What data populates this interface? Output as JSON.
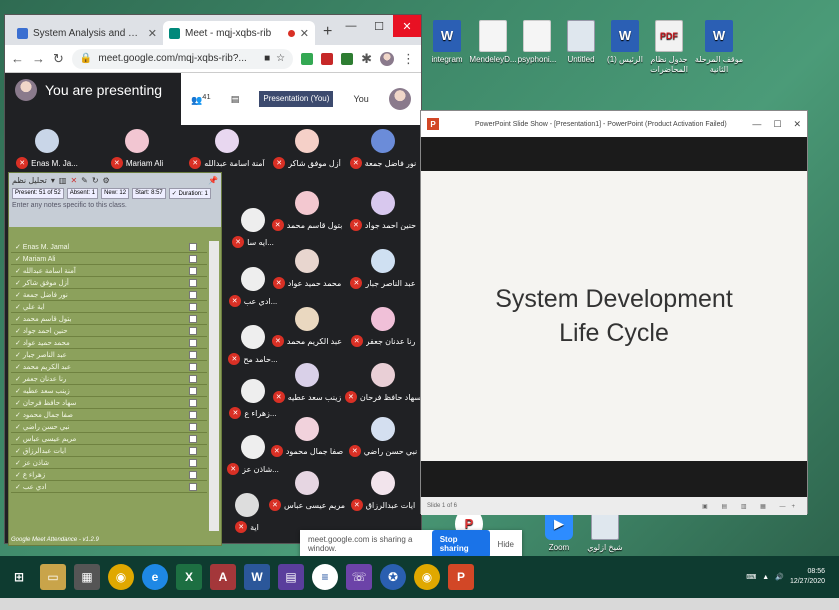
{
  "chrome": {
    "tabs": [
      {
        "title": "System Analysis and Database C",
        "active": false
      },
      {
        "title": "Meet - mqj-xqbs-rib",
        "active": true
      }
    ],
    "url": "meet.google.com/mqj-xqbs-rib?..."
  },
  "meet": {
    "presenting_label": "You are presenting",
    "participant_count": "41",
    "presentation_label": "Presentation (You)",
    "you_label": "You",
    "participants": [
      "Enas M. Ja...",
      "Mariam Ali",
      "آمنة اسامة عبدالله",
      "أزل موفق شاكر",
      "نور فاضل جمعة",
      "بتول قاسم محمد",
      "حنين احمد جواد",
      "محمد حميد عواد",
      "عبد الناصر جبار",
      "عبد الكريم محمد",
      "رنا عدنان جعفر",
      "زينب سعد عطيه",
      "سهاد حافظ فرحان",
      "صفا جمال محمود",
      "نبي حسن راضي",
      "مريم عيسى عباس",
      "ايات عبدالرزاق",
      "اية",
      "ايه سا...",
      "ادي عب...",
      "حامد مح...",
      "زهراء ع...",
      "شاذن عز..."
    ]
  },
  "attendance": {
    "title": "تحليل نظم",
    "present": "Present: 51 of 52",
    "absent": "Absent: 1",
    "new": "New: 12",
    "start": "Start: 8:57",
    "duration": "✓ Duration: 1",
    "note_placeholder": "Enter any notes specific to this class.",
    "rows": [
      "Enas M. Jamal",
      "Mariam Ali",
      "آمنة اسامة عبدالله",
      "أزل موفق شاكر",
      "نور فاضل جمعة",
      "اية علي",
      "بتول قاسم محمد",
      "حنين احمد جواد",
      "محمد حميد عواد",
      "عبد الناصر جبار",
      "عبد الكريم محمد",
      "رنا عدنان جعفر",
      "زينب سعد عطيه",
      "سهاد حافظ فرحان",
      "صفا جمال محمود",
      "نبي حسن راضي",
      "مريم عيسى عباس",
      "ايات عبدالرزاق",
      "شاذن عز",
      "زهراء ع",
      "ادي عب"
    ],
    "footer": "Google Meet Attendance - v1.2.9"
  },
  "share_bar": {
    "message": "meet.google.com is sharing a window.",
    "stop_label": "Stop sharing",
    "hide_label": "Hide"
  },
  "ppt": {
    "window_title": "PowerPoint Slide Show - [Presentation1] - PowerPoint (Product Activation Failed)",
    "slide_title": "System Development Life Cycle",
    "status": "Slide 1 of 6"
  },
  "desktop_icons": [
    {
      "label": "integram",
      "kind": "word"
    },
    {
      "label": "MendeleyD...",
      "kind": "file"
    },
    {
      "label": "psyphoni...",
      "kind": "file"
    },
    {
      "label": "Untitled",
      "kind": "img"
    },
    {
      "label": "(1) الرئيس",
      "kind": "word"
    },
    {
      "label": "جدول نظام المحاضرات",
      "kind": "pdf"
    },
    {
      "label": "موقف المرحلة الثانية",
      "kind": "word"
    }
  ],
  "lower_icons": [
    {
      "label": "",
      "kind": "pp"
    },
    {
      "label": "Zoom",
      "kind": "zoom"
    },
    {
      "label": "شيخ ازلوي",
      "kind": "img"
    }
  ],
  "taskbar": {
    "time": "08:56",
    "date": "12/27/2020",
    "items": [
      "start",
      "explorer",
      "photos",
      "chrome",
      "ie",
      "excel",
      "access",
      "word",
      "app",
      "media",
      "viber",
      "app2",
      "chrome2",
      "powerpoint"
    ]
  },
  "colors": {
    "chrome_close": "#e81123",
    "mic_off": "#d93025",
    "stop_sharing": "#1a73e8",
    "ppt_brand": "#d24726"
  }
}
